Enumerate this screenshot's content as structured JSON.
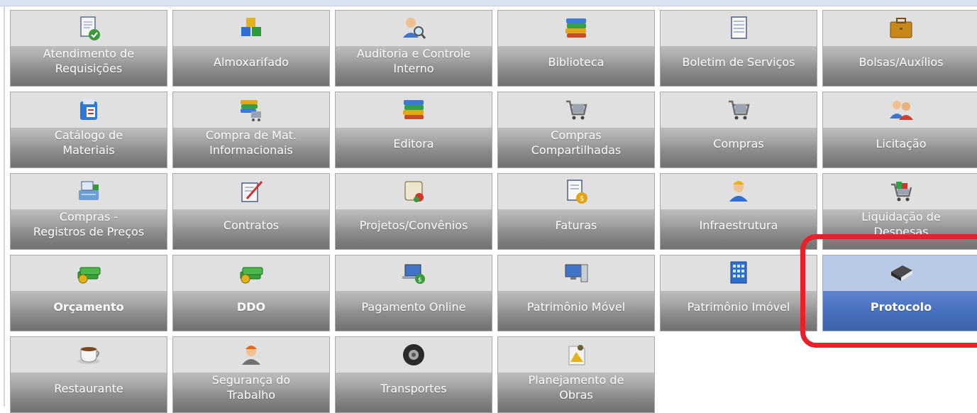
{
  "tiles": [
    {
      "label": "Atendimento de\nRequisições",
      "icon": "document-check-icon"
    },
    {
      "label": "Almoxarifado",
      "icon": "colored-blocks-icon"
    },
    {
      "label": "Auditoria e Controle\nInterno",
      "icon": "user-magnifier-icon"
    },
    {
      "label": "Biblioteca",
      "icon": "books-stack-icon"
    },
    {
      "label": "Boletim de Serviços",
      "icon": "notepad-icon"
    },
    {
      "label": "Bolsas/Auxílios",
      "icon": "briefcase-icon"
    },
    {
      "label": "Catálogo de\nMateriais",
      "icon": "catalog-icon"
    },
    {
      "label": "Compra de Mat.\nInformacionais",
      "icon": "books-cart-icon"
    },
    {
      "label": "Editora",
      "icon": "books-stack-icon"
    },
    {
      "label": "Compras\nCompartilhadas",
      "icon": "shopping-cart-icon"
    },
    {
      "label": "Compras",
      "icon": "shopping-cart-icon"
    },
    {
      "label": "Licitação",
      "icon": "users-icon"
    },
    {
      "label": "Compras -\nRegistros de Preços",
      "icon": "cash-register-icon"
    },
    {
      "label": "Contratos",
      "icon": "contract-pen-icon"
    },
    {
      "label": "Projetos/Convênios",
      "icon": "scroll-icon"
    },
    {
      "label": "Faturas",
      "icon": "invoice-coin-icon"
    },
    {
      "label": "Infraestrutura",
      "icon": "worker-icon"
    },
    {
      "label": "Liquidação de\nDespesas",
      "icon": "cart-items-icon"
    },
    {
      "label": "Orçamento",
      "icon": "money-stack-icon",
      "bold": true
    },
    {
      "label": "DDO",
      "icon": "money-stack-icon",
      "bold": true
    },
    {
      "label": "Pagamento Online",
      "icon": "laptop-coin-icon"
    },
    {
      "label": "Patrimônio Móvel",
      "icon": "computer-icon"
    },
    {
      "label": "Patrimônio Imóvel",
      "icon": "building-icon"
    },
    {
      "label": "Protocolo",
      "icon": "book-icon",
      "bold": true,
      "active": true
    },
    {
      "label": "Restaurante",
      "icon": "coffee-cup-icon"
    },
    {
      "label": "Segurança do\nTrabalho",
      "icon": "hardhat-worker-icon"
    },
    {
      "label": "Transportes",
      "icon": "tire-icon"
    },
    {
      "label": "Planejamento de\nObras",
      "icon": "blueprint-icon"
    }
  ],
  "colors": {
    "tile_top": "#e0e0e0",
    "tile_bottom": "#8d8d8d",
    "active_top": "#b9cae6",
    "active_bottom": "#4770bd",
    "highlight": "#e8202a"
  }
}
